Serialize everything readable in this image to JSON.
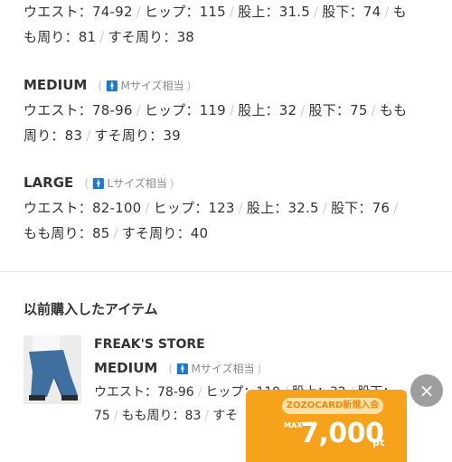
{
  "size_details": {
    "small_continued": {
      "line1": [
        "ウエスト：74-92",
        "ヒップ：115",
        "股上：31.5",
        "股下：74",
        "も"
      ],
      "line2": [
        "も周り：81",
        "すそ周り：38"
      ]
    },
    "medium": {
      "name": "MEDIUM",
      "note": "Mサイズ相当",
      "line1": [
        "ウエスト：78-96",
        "ヒップ：119",
        "股上：32",
        "股下：75",
        "もも"
      ],
      "line2": [
        "周り：83",
        "すそ周り：39"
      ]
    },
    "large": {
      "name": "LARGE",
      "note": "Lサイズ相当",
      "line1": [
        "ウエスト：82-100",
        "ヒップ：123",
        "股上：32.5",
        "股下：76"
      ],
      "line2": [
        "もも周り：85",
        "すそ周り：40"
      ]
    },
    "separator": "/"
  },
  "purchased": {
    "title": "以前購入したアイテム",
    "item": {
      "brand": "FREAK'S STORE",
      "size_name": "MEDIUM",
      "size_note": "Mサイズ相当",
      "line1": [
        "ウエスト：78-96",
        "ヒップ：119",
        "股上：32",
        "股下："
      ],
      "line2": [
        "75",
        "もも周り：83",
        "すそ"
      ]
    }
  },
  "close_button": {
    "glyph": "×"
  },
  "promo_banner": {
    "label": "ZOZOCARD新規入会",
    "max": "MAX",
    "amount": "7,000",
    "unit": "pt"
  },
  "colors": {
    "accent_blue": "#1f78c8",
    "promo_orange": "#f7a21b"
  }
}
